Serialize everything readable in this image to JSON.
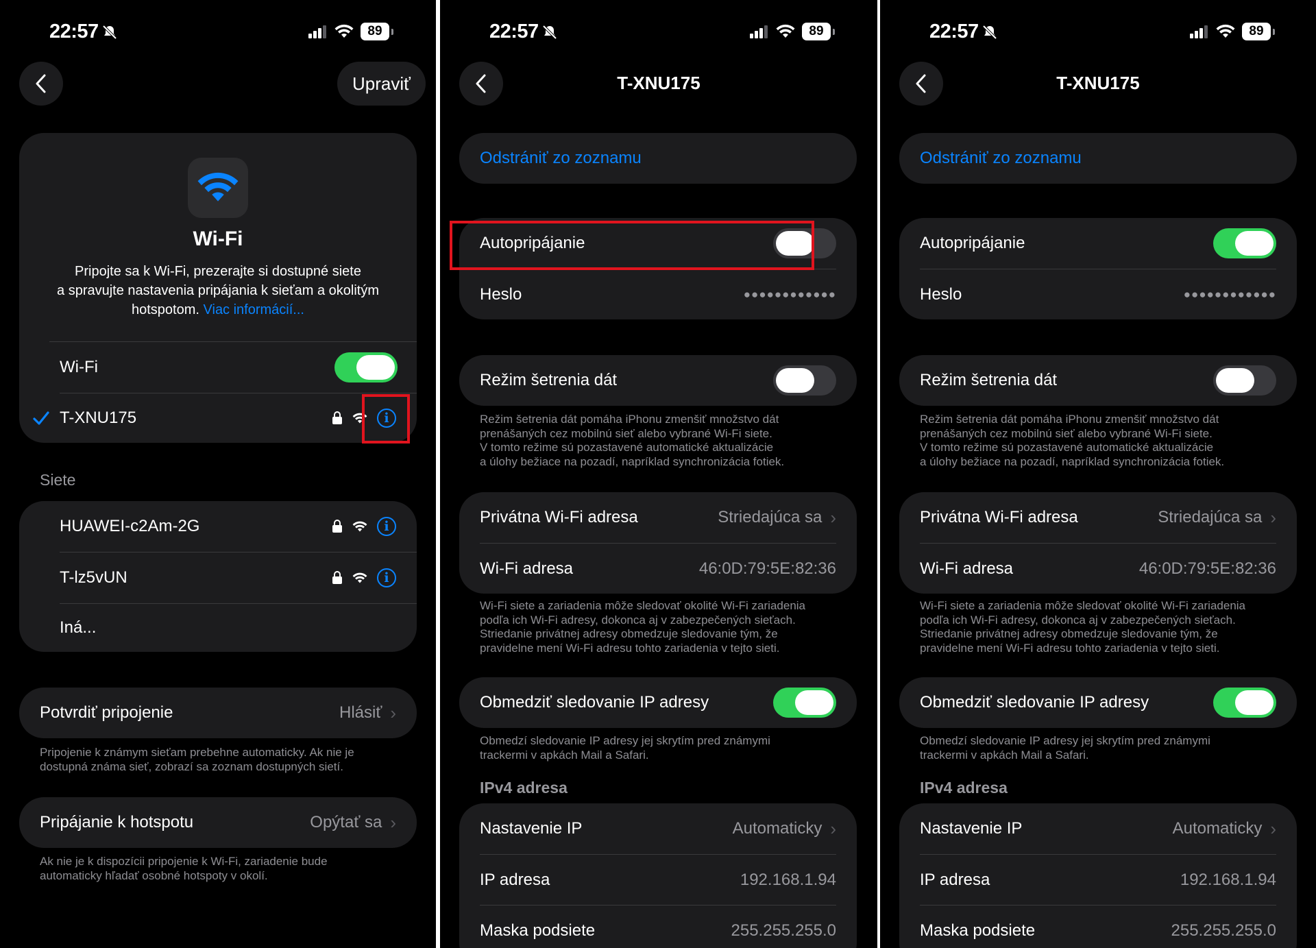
{
  "status": {
    "time": "22:57",
    "battery": "89"
  },
  "wifi_list": {
    "edit_label": "Upraviť",
    "hero_title": "Wi-Fi",
    "hero_desc_line1": "Pripojte sa k Wi-Fi, prezerajte si dostupné siete",
    "hero_desc_line2": "a spravujte nastavenia pripájania k sieťam a okolitým",
    "hero_desc_line3": "hotspotom.",
    "more_info_link": "Viac informácií...",
    "wifi_label": "Wi-Fi",
    "wifi_on": true,
    "connected_network": "T-XNU175",
    "networks_header": "Siete",
    "networks": [
      {
        "name": "HUAWEI-c2Am-2G"
      },
      {
        "name": "T-lz5vUN"
      }
    ],
    "other_label": "Iná...",
    "ask_join_label": "Potvrdiť pripojenie",
    "ask_join_value": "Hlásiť",
    "ask_join_note_line1": "Pripojenie k známym sieťam prebehne automaticky. Ak nie je",
    "ask_join_note_line2": "dostupná známa sieť, zobrazí sa zoznam dostupných sietí.",
    "hotspot_label": "Pripájanie k hotspotu",
    "hotspot_value": "Opýtať sa",
    "hotspot_note_line1": "Ak nie je k dispozícii pripojenie k Wi-Fi, zariadenie bude",
    "hotspot_note_line2": "automaticky hľadať osobné hotspoty v okolí."
  },
  "detail": {
    "title": "T-XNU175",
    "forget_label": "Odstrániť zo zoznamu",
    "auto_join_label": "Autopripájanie",
    "password_label": "Heslo",
    "password_value": "●●●●●●●●●●●●",
    "low_data_label": "Režim šetrenia dát",
    "low_data_note_line1": "Režim šetrenia dát pomáha iPhonu zmenšiť množstvo dát",
    "low_data_note_line2": "prenášaných cez mobilnú sieť alebo vybrané Wi-Fi siete.",
    "low_data_note_line3": "V tomto režime sú pozastavené automatické aktualizácie",
    "low_data_note_line4": "a úlohy bežiace na pozadí, napríklad synchronizácia fotiek.",
    "private_addr_label": "Privátna Wi-Fi adresa",
    "private_addr_value": "Striedajúca sa",
    "wifi_addr_label": "Wi-Fi adresa",
    "wifi_addr_value": "46:0D:79:5E:82:36",
    "private_note_line1": "Wi-Fi siete a zariadenia môže sledovať okolité Wi-Fi zariadenia",
    "private_note_line2": "podľa ich Wi-Fi adresy, dokonca aj v zabezpečených sieťach.",
    "private_note_line3": "Striedanie privátnej adresy obmedzuje sledovanie tým, že",
    "private_note_line4": "pravidelne mení Wi-Fi adresu tohto zariadenia v tejto sieti.",
    "limit_ip_label": "Obmedziť sledovanie IP adresy",
    "limit_ip_note_line1": "Obmedzí sledovanie IP adresy jej skrytím pred známymi",
    "limit_ip_note_line2": "trackermi v apkách Mail a Safari.",
    "ipv4_header": "IPv4 adresa",
    "configure_ip_label": "Nastavenie IP",
    "configure_ip_value": "Automaticky",
    "ip_label": "IP adresa",
    "ip_value": "192.168.1.94",
    "subnet_label": "Maska podsiete",
    "subnet_value": "255.255.255.0"
  },
  "screen2": {
    "auto_join_on": false,
    "low_data_on": false,
    "limit_ip_on": true
  },
  "screen3": {
    "auto_join_on": true,
    "low_data_on": false,
    "limit_ip_on": true
  },
  "colors": {
    "accent": "#0a84ff",
    "toggle_on": "#30d158",
    "highlight": "#e0141e",
    "card": "#1c1c1e"
  }
}
